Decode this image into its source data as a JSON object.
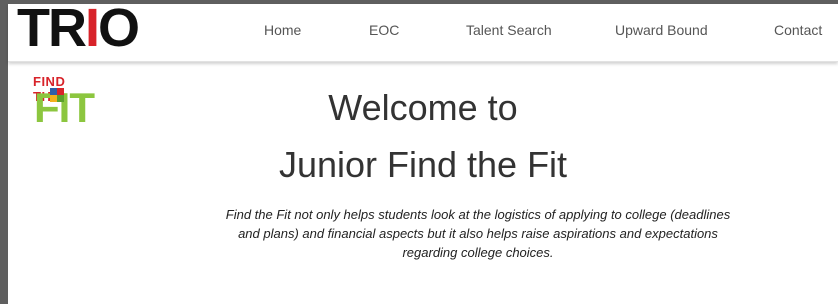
{
  "header": {
    "logo": {
      "part1": "TR",
      "part2": "I",
      "part3": "O"
    },
    "nav": [
      {
        "label": "Home"
      },
      {
        "label": "EOC"
      },
      {
        "label": "Talent Search"
      },
      {
        "label": "Upward Bound"
      },
      {
        "label": "Contact"
      }
    ]
  },
  "badge": {
    "top": "FIND THE",
    "bottom": "FIT"
  },
  "main": {
    "title_line1": "Welcome to",
    "title_line2": "Junior Find the Fit",
    "description": "Find the Fit not only helps students look at the logistics of applying to college (deadlines and plans) and financial aspects but it also helps raise aspirations and expectations regarding college choices."
  },
  "colors": {
    "brand_red": "#d8232a",
    "brand_green": "#8cc63f",
    "text_dark": "#333333",
    "nav_text": "#555555"
  }
}
